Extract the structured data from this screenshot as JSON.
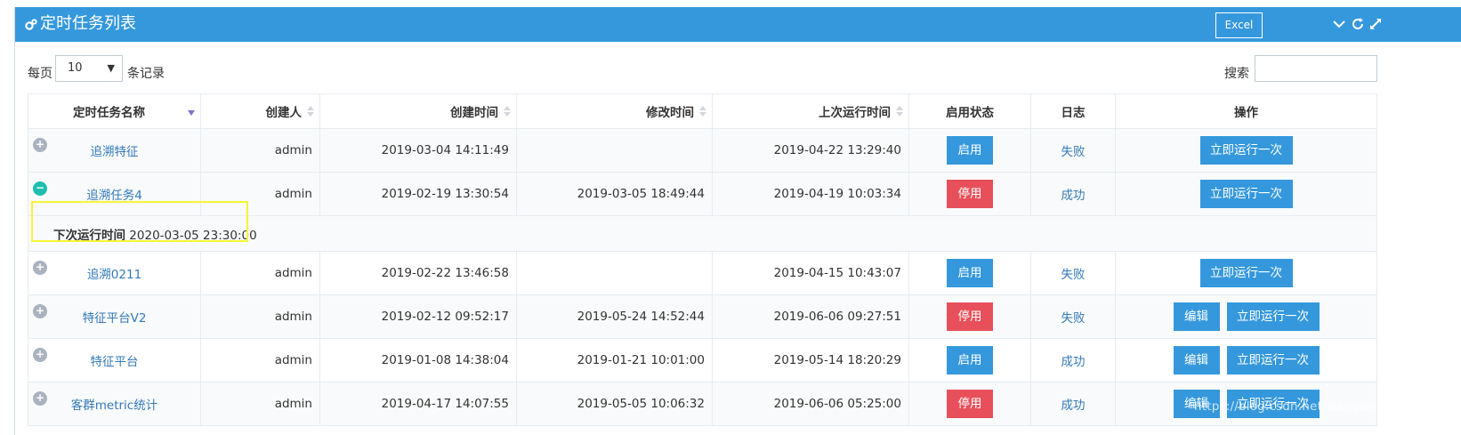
{
  "header": {
    "title": "定时任务列表",
    "excel_label": "Excel",
    "icons": [
      "cogs-icon",
      "chevron-down-icon",
      "refresh-icon",
      "fullscreen-icon"
    ]
  },
  "controls": {
    "per_page_prefix": "每页",
    "per_page_value": "10",
    "per_page_suffix": "条记录",
    "search_label": "搜索",
    "search_value": ""
  },
  "table": {
    "columns": [
      "定时任务名称",
      "创建人",
      "创建时间",
      "修改时间",
      "上次运行时间",
      "启用状态",
      "日志",
      "操作"
    ],
    "rows": [
      {
        "name": "追溯特征",
        "creator": "admin",
        "created": "2019-03-04 14:11:49",
        "modified": "",
        "last_run": "2019-04-22 13:29:40",
        "status": "启用",
        "log": "失败",
        "edit": "",
        "run": "立即运行一次"
      },
      {
        "name": "追溯任务4",
        "creator": "admin",
        "created": "2019-02-19 13:30:54",
        "modified": "2019-03-05 18:49:44",
        "last_run": "2019-04-19 10:03:34",
        "status": "停用",
        "log": "成功",
        "edit": "",
        "run": "立即运行一次"
      },
      {
        "name": "追溯0211",
        "creator": "admin",
        "created": "2019-02-22 13:46:58",
        "modified": "",
        "last_run": "2019-04-15 10:43:07",
        "status": "启用",
        "log": "失败",
        "edit": "",
        "run": "立即运行一次"
      },
      {
        "name": "特征平台V2",
        "creator": "admin",
        "created": "2019-02-12 09:52:17",
        "modified": "2019-05-24 14:52:44",
        "last_run": "2019-06-06 09:27:51",
        "status": "停用",
        "log": "失败",
        "edit": "编辑",
        "run": "立即运行一次"
      },
      {
        "name": "特征平台",
        "creator": "admin",
        "created": "2019-01-08 14:38:04",
        "modified": "2019-01-21 10:01:00",
        "last_run": "2019-05-14 18:20:29",
        "status": "启用",
        "log": "成功",
        "edit": "编辑",
        "run": "立即运行一次"
      },
      {
        "name": "客群metric统计",
        "creator": "admin",
        "created": "2019-04-17 14:07:55",
        "modified": "2019-05-05 10:06:32",
        "last_run": "2019-06-06 05:25:00",
        "status": "停用",
        "log": "成功",
        "edit": "编辑",
        "run": "立即运行一次"
      }
    ],
    "detail": {
      "label": "下次运行时间",
      "value": "2020-03-05 23:30:00"
    }
  },
  "watermark": "https://blog.csdn.net/wangwen_120",
  "colors": {
    "header": "#3598dc",
    "enabled_button": "#3598dc",
    "disabled_button": "#e7505a",
    "highlight_box": "#f5f536"
  }
}
